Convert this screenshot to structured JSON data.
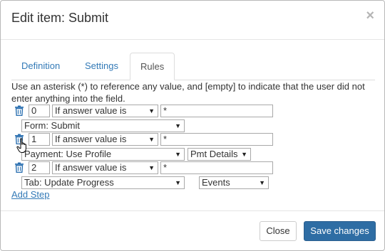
{
  "dialog": {
    "title": "Edit item: Submit",
    "close_glyph": "×"
  },
  "tabs": [
    {
      "label": "Definition",
      "active": false
    },
    {
      "label": "Settings",
      "active": false
    },
    {
      "label": "Rules",
      "active": true
    }
  ],
  "help_text": "Use an asterisk (*) to reference any value, and [empty] to indicate that the user did not enter anything into the field.",
  "rules": [
    {
      "order": "0",
      "condition": "If answer value is",
      "value": "*",
      "target": "Form: Submit",
      "option": ""
    },
    {
      "order": "1",
      "condition": "If answer value is",
      "value": "*",
      "target": "Payment: Use Profile",
      "option": "Pmt Details"
    },
    {
      "order": "2",
      "condition": "If answer value is",
      "value": "*",
      "target": "Tab: Update Progress",
      "option": "Events"
    }
  ],
  "add_step_label": "Add Step",
  "buttons": {
    "close": "Close",
    "save": "Save changes"
  },
  "colors": {
    "link": "#337ab7",
    "primary": "#2e6da4",
    "trash": "#2a6fb0"
  },
  "icons": {
    "delete": "trash-icon",
    "pointer": "hand-cursor-icon"
  }
}
